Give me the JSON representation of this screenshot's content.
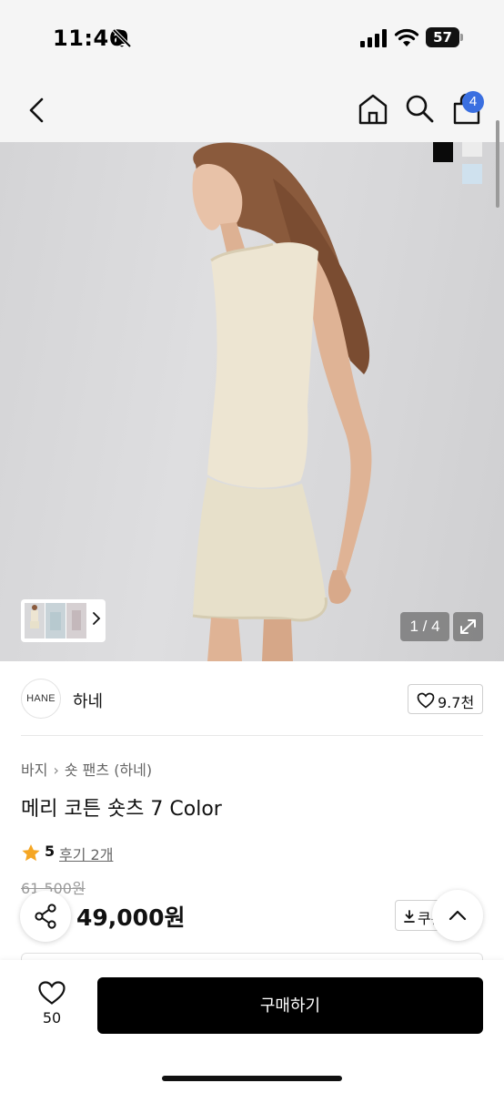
{
  "status": {
    "time": "11:46",
    "battery": "57"
  },
  "nav": {
    "cart_count": "4",
    "icons": [
      "chevron-left-icon",
      "home-icon",
      "search-icon",
      "shopping-bag-icon"
    ]
  },
  "gallery": {
    "page_indicator": "1 / 4",
    "current_page": 1,
    "total_pages": 4,
    "color_swatches": [
      "#0a0a0a",
      "#ececec",
      "#cfe1ee"
    ]
  },
  "brand": {
    "logo_text": "HANE",
    "name": "하네",
    "like_count": "9.7천"
  },
  "product": {
    "breadcrumb": [
      "바지",
      "숏 팬츠 (하네)"
    ],
    "title": "메리 코튼 숏츠 7 Color",
    "rating": "5",
    "review_link": "후기 2개",
    "original_price": "61,500원",
    "sale_price": "49,000원",
    "coupon_label": "쿠폰"
  },
  "bottom_bar": {
    "wish_count": "50",
    "buy_label": "구매하기"
  },
  "colors": {
    "badge": "#3a6fe0",
    "star": "#f5a623",
    "buy_button": "#000000"
  }
}
